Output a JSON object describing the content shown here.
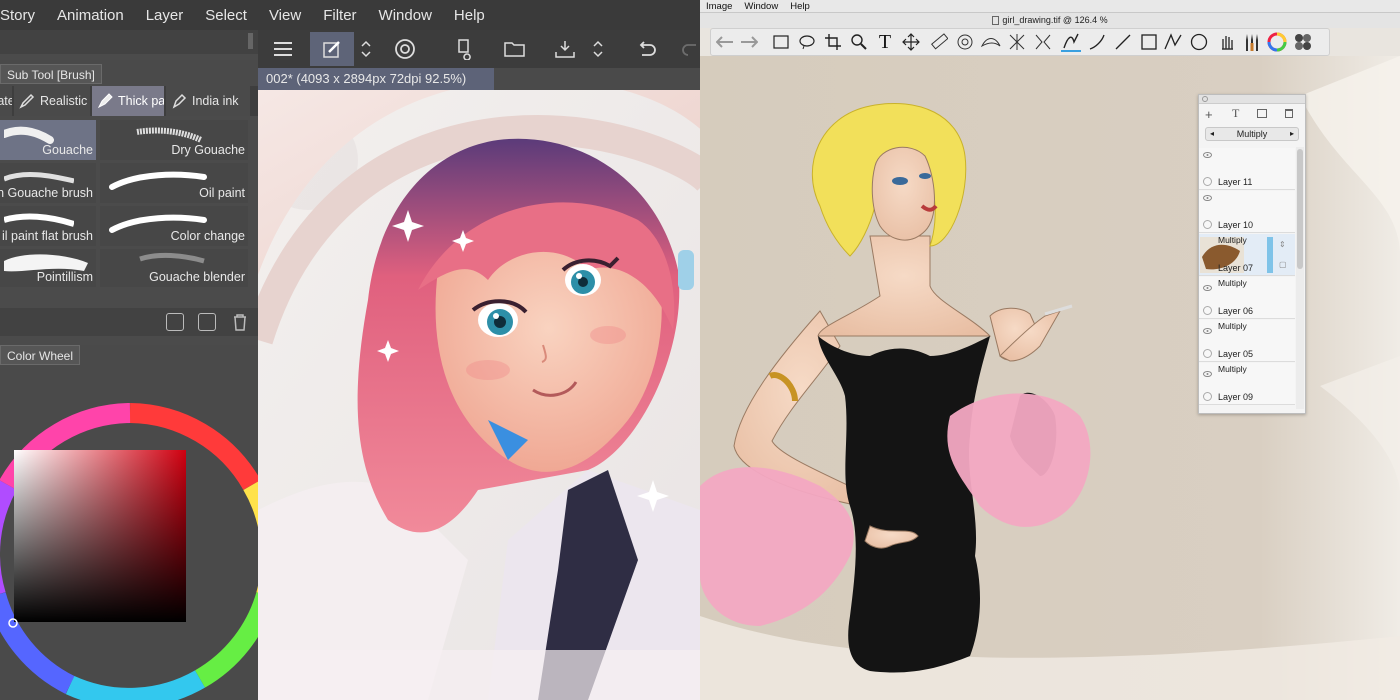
{
  "left_app": {
    "menu": [
      "Story",
      "Animation",
      "Layer",
      "Select",
      "View",
      "Filter",
      "Window",
      "Help"
    ],
    "subtool_tab": "Sub Tool [Brush]",
    "brush_categories": [
      {
        "label": "Waterco",
        "icon": "brush-icon",
        "active": false
      },
      {
        "label": "Realistic",
        "icon": "pencil-brush-icon",
        "active": false
      },
      {
        "label": "Thick pa",
        "icon": "thick-paint-icon",
        "active": true
      },
      {
        "label": "India ink",
        "icon": "pen-nib-icon",
        "active": false
      }
    ],
    "brushes": [
      {
        "label": "Gouache",
        "selected": true
      },
      {
        "label": "Dry Gouache",
        "selected": false
      },
      {
        "label": "n Gouache brush",
        "selected": false
      },
      {
        "label": "Oil paint",
        "selected": false
      },
      {
        "label": "il paint flat brush",
        "selected": false
      },
      {
        "label": "Color change",
        "selected": false
      },
      {
        "label": "Pointillism",
        "selected": false
      },
      {
        "label": "Gouache blender",
        "selected": false
      }
    ],
    "color_wheel_tab": "Color Wheel",
    "doc_tab": "002* (4093 x 2894px 72dpi 92.5%)",
    "toolbar_icons": [
      "menu-icon",
      "edit-brush-icon",
      "up-down-arrow-icon",
      "spiral-icon",
      "new-page-icon",
      "open-folder-icon",
      "save-icon",
      "up-down-arrow-icon",
      "undo-icon",
      "redo-icon"
    ],
    "colors": {
      "menubar": "#3a3a3a",
      "panel": "#4b4b4b",
      "accent": "#6e7386",
      "hat": "#efe0dd",
      "hair": "#e8778a"
    }
  },
  "right_app": {
    "menu": [
      "Image",
      "Window",
      "Help"
    ],
    "title": "girl_drawing.tif @ 126.4 %",
    "toolbar_icons": [
      "back-arrow-icon",
      "forward-arrow-icon",
      "rectangle-select-icon",
      "lasso-icon",
      "crop-icon",
      "zoom-icon",
      "text-icon",
      "move-icon",
      "ruler-icon",
      "french-curve-icon",
      "guide-icon",
      "symmetry-icon",
      "transform-icon",
      "pencil-icon",
      "curve-icon",
      "line-icon",
      "rectangle-icon",
      "polyline-icon",
      "ellipse-icon",
      "hand-icon",
      "brushes-icon",
      "color-wheel-icon",
      "swatches-icon"
    ],
    "layers_panel": {
      "icons": [
        "add-layer-icon",
        "text-layer-icon",
        "image-layer-icon",
        "trash-icon"
      ],
      "blend_mode": "Multiply",
      "layers": [
        {
          "name": "Layer 11",
          "mode": "",
          "selected": false
        },
        {
          "name": "Layer 10",
          "mode": "",
          "selected": false
        },
        {
          "name": "Layer 07",
          "mode": "Multiply",
          "selected": true
        },
        {
          "name": "Layer 06",
          "mode": "Multiply",
          "selected": false
        },
        {
          "name": "Layer 05",
          "mode": "Multiply",
          "selected": false
        },
        {
          "name": "Layer 09",
          "mode": "Multiply",
          "selected": false
        }
      ]
    },
    "colors": {
      "canvas": "#d7cbb9",
      "dress": "#141414",
      "hair": "#f2e05a",
      "boa": "#f4a6c0"
    }
  }
}
